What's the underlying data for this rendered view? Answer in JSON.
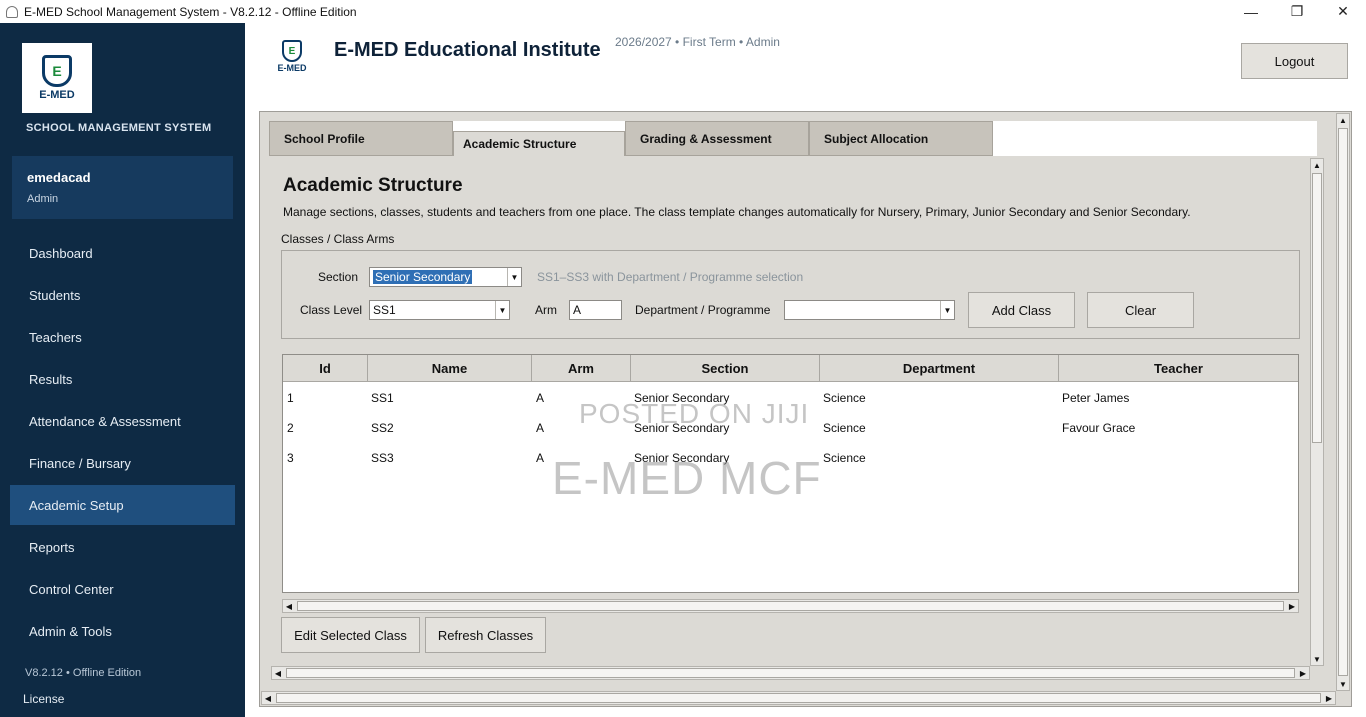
{
  "window": {
    "title": "E-MED School Management System - V8.2.12 - Offline Edition",
    "minimize": "—",
    "maximize": "❐",
    "close": "✕"
  },
  "sidebar": {
    "logo_text": "E-MED",
    "system_name": "SCHOOL MANAGEMENT SYSTEM",
    "user": {
      "name": "emedacad",
      "role": "Admin"
    },
    "items": [
      {
        "label": "Dashboard"
      },
      {
        "label": "Students"
      },
      {
        "label": "Teachers"
      },
      {
        "label": "Results"
      },
      {
        "label": "Attendance & Assessment"
      },
      {
        "label": "Finance / Bursary"
      },
      {
        "label": "Academic Setup",
        "active": true
      },
      {
        "label": "Reports"
      },
      {
        "label": "Control Center"
      },
      {
        "label": "Admin & Tools"
      }
    ],
    "version": "V8.2.12  •  Offline Edition",
    "license": "License"
  },
  "header": {
    "logo_text": "E-MED",
    "institution": "E-MED Educational Institute",
    "meta": "2026/2027  •  First Term  •  Admin",
    "logout_label": "Logout"
  },
  "tabs": [
    {
      "label": "School Profile"
    },
    {
      "label": "Academic Structure",
      "active": true
    },
    {
      "label": "Grading & Assessment"
    },
    {
      "label": "Subject Allocation"
    }
  ],
  "section": {
    "title": "Academic Structure",
    "description": "Manage sections, classes, students and teachers from one place. The class template changes automatically for Nursery, Primary, Junior Secondary and Senior Secondary.",
    "group_label": "Classes / Class Arms"
  },
  "form": {
    "section_label": "Section",
    "section_value": "Senior Secondary",
    "section_hint": "SS1–SS3 with Department / Programme selection",
    "class_level_label": "Class Level",
    "class_level_value": "SS1",
    "arm_label": "Arm",
    "arm_value": "A",
    "department_label": "Department / Programme",
    "department_value": "",
    "add_class_label": "Add Class",
    "clear_label": "Clear"
  },
  "table": {
    "columns": [
      "Id",
      "Name",
      "Arm",
      "Section",
      "Department",
      "Teacher"
    ],
    "rows": [
      [
        "1",
        "SS1",
        "A",
        "Senior Secondary",
        "Science",
        "Peter James"
      ],
      [
        "2",
        "SS2",
        "A",
        "Senior Secondary",
        "Science",
        "Favour Grace"
      ],
      [
        "3",
        "SS3",
        "A",
        "Senior Secondary",
        "Science",
        ""
      ]
    ]
  },
  "actions": {
    "edit_label": "Edit Selected Class",
    "refresh_label": "Refresh Classes"
  },
  "watermark": {
    "line1": "POSTED ON JIJI",
    "line2": "E-MED MCF"
  }
}
